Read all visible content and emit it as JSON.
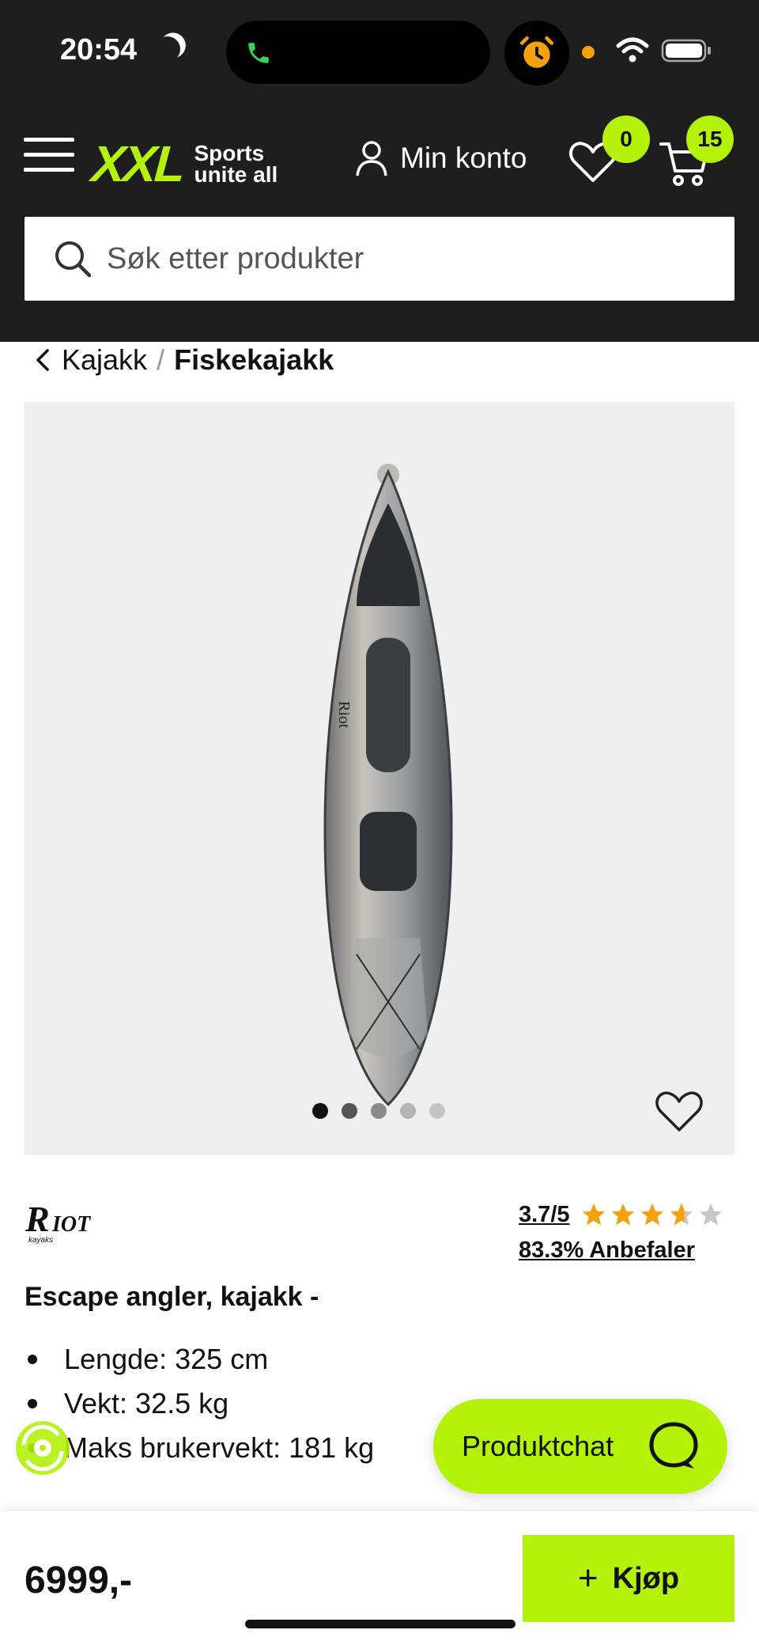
{
  "status_bar": {
    "time": "20:54"
  },
  "header": {
    "logo_main": "XXL",
    "logo_tagline_1": "Sports",
    "logo_tagline_2": "unite all",
    "account_label": "Min konto",
    "wishlist_count": "0",
    "cart_count": "15",
    "search_placeholder": "Søk etter produkter"
  },
  "breadcrumb": {
    "parent": "Kajakk",
    "separator": "/",
    "current": "Fiskekajakk"
  },
  "gallery": {
    "image_count": 5,
    "active_index": 0
  },
  "product": {
    "brand": "RIOT",
    "brand_sub": "kayaks",
    "rating": "3.7/5",
    "rating_value": 3.7,
    "rating_max": 5,
    "recommend": "83.3% Anbefaler",
    "title": "Escape angler, kajakk -",
    "specs": [
      "Lengde: 325 cm",
      "Vekt: 32.5 kg",
      "Maks brukervekt: 181 kg"
    ],
    "price": "6999,-"
  },
  "chat": {
    "label": "Produktchat"
  },
  "buy": {
    "label": "Kjøp"
  },
  "colors": {
    "accent": "#b4f10b",
    "header_bg": "#1e1e1e",
    "star": "#f4a10b"
  }
}
